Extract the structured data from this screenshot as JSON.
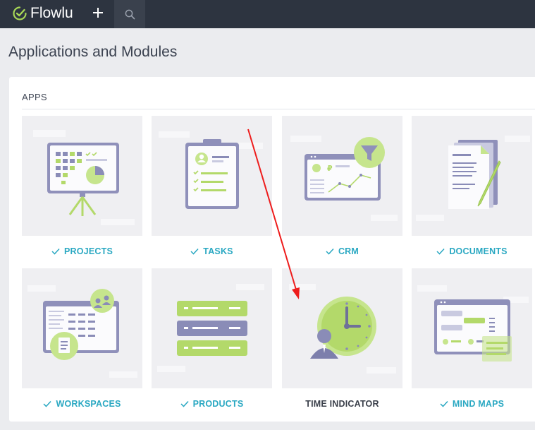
{
  "brand": {
    "name": "Flowlu"
  },
  "page": {
    "title": "Applications and Modules"
  },
  "section": {
    "title": "APPS"
  },
  "colors": {
    "topbar": "#2d3440",
    "accent": "#2aa8c2",
    "lime": "#b3d96a",
    "violet": "#8a8cb7",
    "annotation_arrow": "#ee1c1c"
  },
  "apps": [
    {
      "label": "PROJECTS",
      "installed": true,
      "icon": "presentation-board-icon"
    },
    {
      "label": "TASKS",
      "installed": true,
      "icon": "clipboard-checklist-icon"
    },
    {
      "label": "CRM",
      "installed": true,
      "icon": "sales-funnel-chart-icon"
    },
    {
      "label": "DOCUMENTS",
      "installed": true,
      "icon": "documents-pen-icon"
    },
    {
      "label": "WORKSPACES",
      "installed": true,
      "icon": "workspaces-icon"
    },
    {
      "label": "PRODUCTS",
      "installed": true,
      "icon": "product-list-icon"
    },
    {
      "label": "TIME INDICATOR",
      "installed": false,
      "icon": "clock-person-icon"
    },
    {
      "label": "MIND MAPS",
      "installed": true,
      "icon": "mind-map-icon"
    }
  ]
}
